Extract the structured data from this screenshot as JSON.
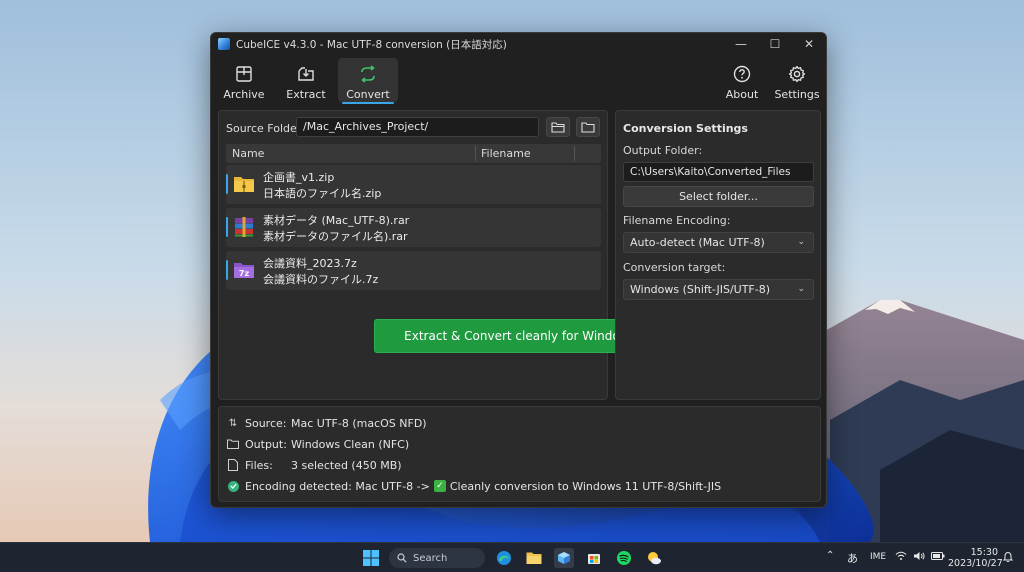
{
  "window": {
    "title": "CubeICE v4.3.0 - Mac UTF-8 conversion (日本語対応)",
    "min_glyph": "—",
    "max_glyph": "☐",
    "close_glyph": "✕"
  },
  "toolbar": {
    "archive": "Archive",
    "extract": "Extract",
    "convert": "Convert",
    "about": "About",
    "settings": "Settings",
    "active": "Convert"
  },
  "source": {
    "label": "Source Folder:",
    "path": "/Mac_Archives_Project/"
  },
  "file_list": {
    "columns": [
      "Name",
      "Filename"
    ],
    "rows": [
      {
        "name": "企画書_v1.zip",
        "filename": "日本語のファイル名.zip",
        "icon": "zip-folder-icon"
      },
      {
        "name": "素材データ (Mac_UTF-8).rar",
        "filename": "素材データのファイル名).rar",
        "icon": "rar-archive-icon"
      },
      {
        "name": "会議資料_2023.7z",
        "filename": "会議資料のファイル.7z",
        "icon": "7z-archive-icon"
      }
    ]
  },
  "action_button": "Extract & Convert cleanly for Windows",
  "settings_panel": {
    "title": "Conversion Settings",
    "output_folder_label": "Output Folder:",
    "output_folder_value": "C:\\Users\\Kaito\\Converted_Files",
    "select_folder": "Select folder...",
    "encoding_label": "Filename Encoding:",
    "encoding_value": "Auto-detect (Mac UTF-8)",
    "target_label": "Conversion target:",
    "target_value": "Windows (Shift-JIS/UTF-8)"
  },
  "status": {
    "source_key": "Source:",
    "source_val": "Mac UTF-8 (macOS NFD)",
    "output_key": "Output:",
    "output_val": "Windows Clean (NFC)",
    "files_key": "Files:",
    "files_val": "3 selected (450 MB)",
    "detect_text_1": "Encoding detected: Mac UTF-8 ->",
    "detect_text_2": "Cleanly conversion to Windows 11 UTF-8/Shift-JIS"
  },
  "taskbar": {
    "search_placeholder": "Search",
    "ime_kana": "あ",
    "ime": "IME",
    "time": "15:30",
    "date": "2023/10/27"
  },
  "colors": {
    "accent": "#3aa5e8",
    "primary_button": "#1f9a3f",
    "window_bg": "#202020",
    "panel_bg": "#2b2b2b"
  }
}
